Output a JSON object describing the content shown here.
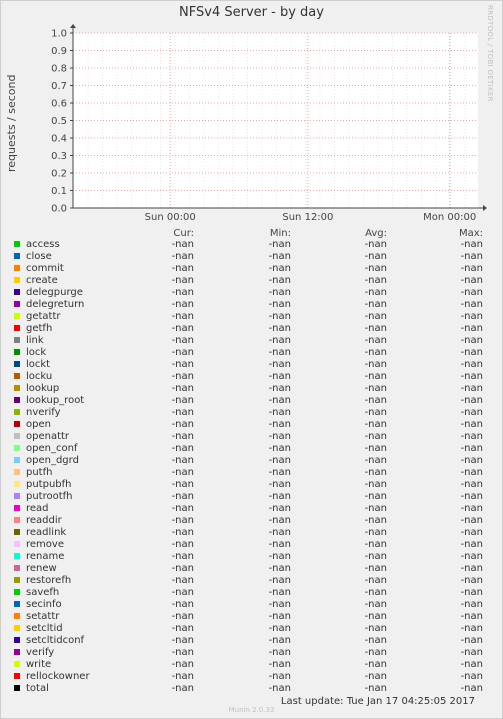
{
  "chart_data": {
    "type": "line",
    "title": "NFSv4 Server - by day",
    "ylabel": "requests / second",
    "xlabel": "",
    "ylim": [
      0.0,
      1.0
    ],
    "yticks": [
      "0.0",
      "0.1",
      "0.2",
      "0.3",
      "0.4",
      "0.5",
      "0.6",
      "0.7",
      "0.8",
      "0.9",
      "1.0"
    ],
    "xticks": [
      "Sun 00:00",
      "Sun 12:00",
      "Mon 00:00"
    ],
    "grid": true,
    "series_values_note": "",
    "legend_columns": [
      "Cur:",
      "Min:",
      "Avg:",
      "Max:"
    ],
    "series": [
      {
        "name": "access",
        "color": "#00cc00",
        "cur": "-nan",
        "min": "-nan",
        "avg": "-nan",
        "max": "-nan"
      },
      {
        "name": "close",
        "color": "#0066b3",
        "cur": "-nan",
        "min": "-nan",
        "avg": "-nan",
        "max": "-nan"
      },
      {
        "name": "commit",
        "color": "#ff8000",
        "cur": "-nan",
        "min": "-nan",
        "avg": "-nan",
        "max": "-nan"
      },
      {
        "name": "create",
        "color": "#ffcc00",
        "cur": "-nan",
        "min": "-nan",
        "avg": "-nan",
        "max": "-nan"
      },
      {
        "name": "delegpurge",
        "color": "#330099",
        "cur": "-nan",
        "min": "-nan",
        "avg": "-nan",
        "max": "-nan"
      },
      {
        "name": "delegreturn",
        "color": "#990099",
        "cur": "-nan",
        "min": "-nan",
        "avg": "-nan",
        "max": "-nan"
      },
      {
        "name": "getattr",
        "color": "#ccff00",
        "cur": "-nan",
        "min": "-nan",
        "avg": "-nan",
        "max": "-nan"
      },
      {
        "name": "getfh",
        "color": "#ff0000",
        "cur": "-nan",
        "min": "-nan",
        "avg": "-nan",
        "max": "-nan"
      },
      {
        "name": "link",
        "color": "#808080",
        "cur": "-nan",
        "min": "-nan",
        "avg": "-nan",
        "max": "-nan"
      },
      {
        "name": "lock",
        "color": "#008f00",
        "cur": "-nan",
        "min": "-nan",
        "avg": "-nan",
        "max": "-nan"
      },
      {
        "name": "lockt",
        "color": "#00487d",
        "cur": "-nan",
        "min": "-nan",
        "avg": "-nan",
        "max": "-nan"
      },
      {
        "name": "locku",
        "color": "#b35a00",
        "cur": "-nan",
        "min": "-nan",
        "avg": "-nan",
        "max": "-nan"
      },
      {
        "name": "lookup",
        "color": "#b38f00",
        "cur": "-nan",
        "min": "-nan",
        "avg": "-nan",
        "max": "-nan"
      },
      {
        "name": "lookup_root",
        "color": "#6b006b",
        "cur": "-nan",
        "min": "-nan",
        "avg": "-nan",
        "max": "-nan"
      },
      {
        "name": "nverify",
        "color": "#8fb300",
        "cur": "-nan",
        "min": "-nan",
        "avg": "-nan",
        "max": "-nan"
      },
      {
        "name": "open",
        "color": "#b30000",
        "cur": "-nan",
        "min": "-nan",
        "avg": "-nan",
        "max": "-nan"
      },
      {
        "name": "openattr",
        "color": "#bebebe",
        "cur": "-nan",
        "min": "-nan",
        "avg": "-nan",
        "max": "-nan"
      },
      {
        "name": "open_conf",
        "color": "#80ff80",
        "cur": "-nan",
        "min": "-nan",
        "avg": "-nan",
        "max": "-nan"
      },
      {
        "name": "open_dgrd",
        "color": "#80c9ff",
        "cur": "-nan",
        "min": "-nan",
        "avg": "-nan",
        "max": "-nan"
      },
      {
        "name": "putfh",
        "color": "#ffc080",
        "cur": "-nan",
        "min": "-nan",
        "avg": "-nan",
        "max": "-nan"
      },
      {
        "name": "putpubfh",
        "color": "#ffe680",
        "cur": "-nan",
        "min": "-nan",
        "avg": "-nan",
        "max": "-nan"
      },
      {
        "name": "putrootfh",
        "color": "#aa80ff",
        "cur": "-nan",
        "min": "-nan",
        "avg": "-nan",
        "max": "-nan"
      },
      {
        "name": "read",
        "color": "#ee00cc",
        "cur": "-nan",
        "min": "-nan",
        "avg": "-nan",
        "max": "-nan"
      },
      {
        "name": "readdir",
        "color": "#ff8080",
        "cur": "-nan",
        "min": "-nan",
        "avg": "-nan",
        "max": "-nan"
      },
      {
        "name": "readlink",
        "color": "#666600",
        "cur": "-nan",
        "min": "-nan",
        "avg": "-nan",
        "max": "-nan"
      },
      {
        "name": "remove",
        "color": "#ffbfff",
        "cur": "-nan",
        "min": "-nan",
        "avg": "-nan",
        "max": "-nan"
      },
      {
        "name": "rename",
        "color": "#00ffcc",
        "cur": "-nan",
        "min": "-nan",
        "avg": "-nan",
        "max": "-nan"
      },
      {
        "name": "renew",
        "color": "#cc6699",
        "cur": "-nan",
        "min": "-nan",
        "avg": "-nan",
        "max": "-nan"
      },
      {
        "name": "restorefh",
        "color": "#999900",
        "cur": "-nan",
        "min": "-nan",
        "avg": "-nan",
        "max": "-nan"
      },
      {
        "name": "savefh",
        "color": "#00cc00",
        "cur": "-nan",
        "min": "-nan",
        "avg": "-nan",
        "max": "-nan"
      },
      {
        "name": "secinfo",
        "color": "#0066b3",
        "cur": "-nan",
        "min": "-nan",
        "avg": "-nan",
        "max": "-nan"
      },
      {
        "name": "setattr",
        "color": "#ff8000",
        "cur": "-nan",
        "min": "-nan",
        "avg": "-nan",
        "max": "-nan"
      },
      {
        "name": "setcltid",
        "color": "#ffcc00",
        "cur": "-nan",
        "min": "-nan",
        "avg": "-nan",
        "max": "-nan"
      },
      {
        "name": "setcltidconf",
        "color": "#330099",
        "cur": "-nan",
        "min": "-nan",
        "avg": "-nan",
        "max": "-nan"
      },
      {
        "name": "verify",
        "color": "#990099",
        "cur": "-nan",
        "min": "-nan",
        "avg": "-nan",
        "max": "-nan"
      },
      {
        "name": "write",
        "color": "#ccff00",
        "cur": "-nan",
        "min": "-nan",
        "avg": "-nan",
        "max": "-nan"
      },
      {
        "name": "rellockowner",
        "color": "#ff0000",
        "cur": "-nan",
        "min": "-nan",
        "avg": "-nan",
        "max": "-nan"
      },
      {
        "name": "total",
        "color": "#000000",
        "cur": "-nan",
        "min": "-nan",
        "avg": "-nan",
        "max": "-nan"
      }
    ]
  },
  "watermark": "RRDTOOL / TOBI OETIKER",
  "last_update": "Last update:  Tue Jan 17 04:25:05 2017",
  "footer": "Munin 2.0.33"
}
